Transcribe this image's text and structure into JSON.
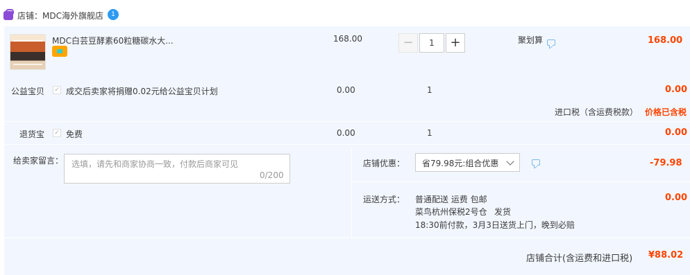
{
  "shop": {
    "label": "店铺：MDC海外旗舰店",
    "ww_badge": "1",
    "icons": [
      "shop-bag-icon",
      "wangwang-chat-icon"
    ]
  },
  "item": {
    "title": "MDC白芸豆酵素60粒糖碳水大...",
    "price": "168.00",
    "quantity": "1",
    "minus": "−",
    "plus": "+",
    "promo": "聚划算",
    "subtotal": "168.00"
  },
  "charity": {
    "label": "公益宝贝",
    "desc": "成交后卖家将捐赠0.02元给公益宝贝计划",
    "price": "0.00",
    "quantity": "1",
    "subtotal": "0.00"
  },
  "import_tax": {
    "label": "进口税（含运费税款）",
    "value": "价格已含税"
  },
  "return_ins": {
    "label": "退货宝",
    "desc": "免费",
    "price": "0.00",
    "quantity": "1",
    "subtotal": "0.00"
  },
  "message": {
    "label": "给卖家留言：",
    "placeholder": "选填，请先和商家协商一致，付款后商家可见",
    "count": "0/200"
  },
  "discount": {
    "label": "店铺优惠：",
    "selected": "省79.98元:组合优惠",
    "value": "-79.98"
  },
  "shipping": {
    "label": "运送方式：",
    "line1": "普通配送 运费 包邮",
    "line2": "菜鸟杭州保税2号仓",
    "line2b": "发货",
    "line3": "18:30前付款，3月3日送货上门，晚到必赔",
    "value": "0.00"
  },
  "total": {
    "label": "店铺合计(含运费和进口税)",
    "value": "¥88.02"
  },
  "colors": {
    "accent_red": "#ff4400",
    "panel_bg": "#f2f7ff",
    "shop_icon": "#8a4bd6",
    "chat_blue": "#2f9af2"
  }
}
